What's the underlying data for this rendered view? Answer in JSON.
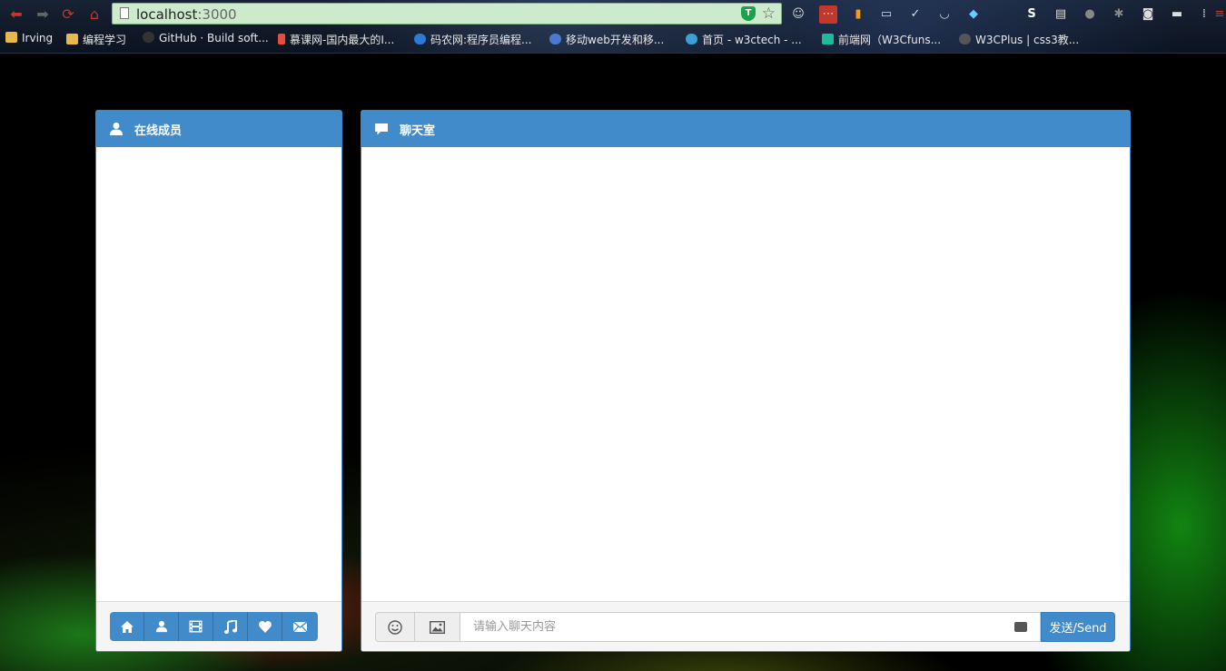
{
  "browser": {
    "url_host": "localhost",
    "url_port": ":3000",
    "bookmarks": [
      {
        "label": "Irving",
        "icon": "folder-icon"
      },
      {
        "label": "编程学习",
        "icon": "folder-icon"
      },
      {
        "label": "GitHub · Build soft...",
        "icon": "github-icon"
      },
      {
        "label": "慕课网-国内最大的I...",
        "icon": "imooc-icon"
      },
      {
        "label": "码农网:程序员编程...",
        "icon": "codeceo-icon"
      },
      {
        "label": "移动web开发和移...",
        "icon": "mobile-web-icon"
      },
      {
        "label": "首页 - w3ctech - ...",
        "icon": "w3ctech-icon"
      },
      {
        "label": "前端网（W3Cfuns...",
        "icon": "w3cfuns-icon"
      },
      {
        "label": "W3CPlus | css3教...",
        "icon": "w3cplus-icon"
      }
    ]
  },
  "members": {
    "title": "在线成员",
    "toolbar_icons": [
      "home-icon",
      "user-icon",
      "film-icon",
      "music-icon",
      "heart-icon",
      "envelope-icon"
    ]
  },
  "chat": {
    "title": "聊天室",
    "input_placeholder": "请输入聊天内容",
    "send_label": "发送/Send"
  }
}
